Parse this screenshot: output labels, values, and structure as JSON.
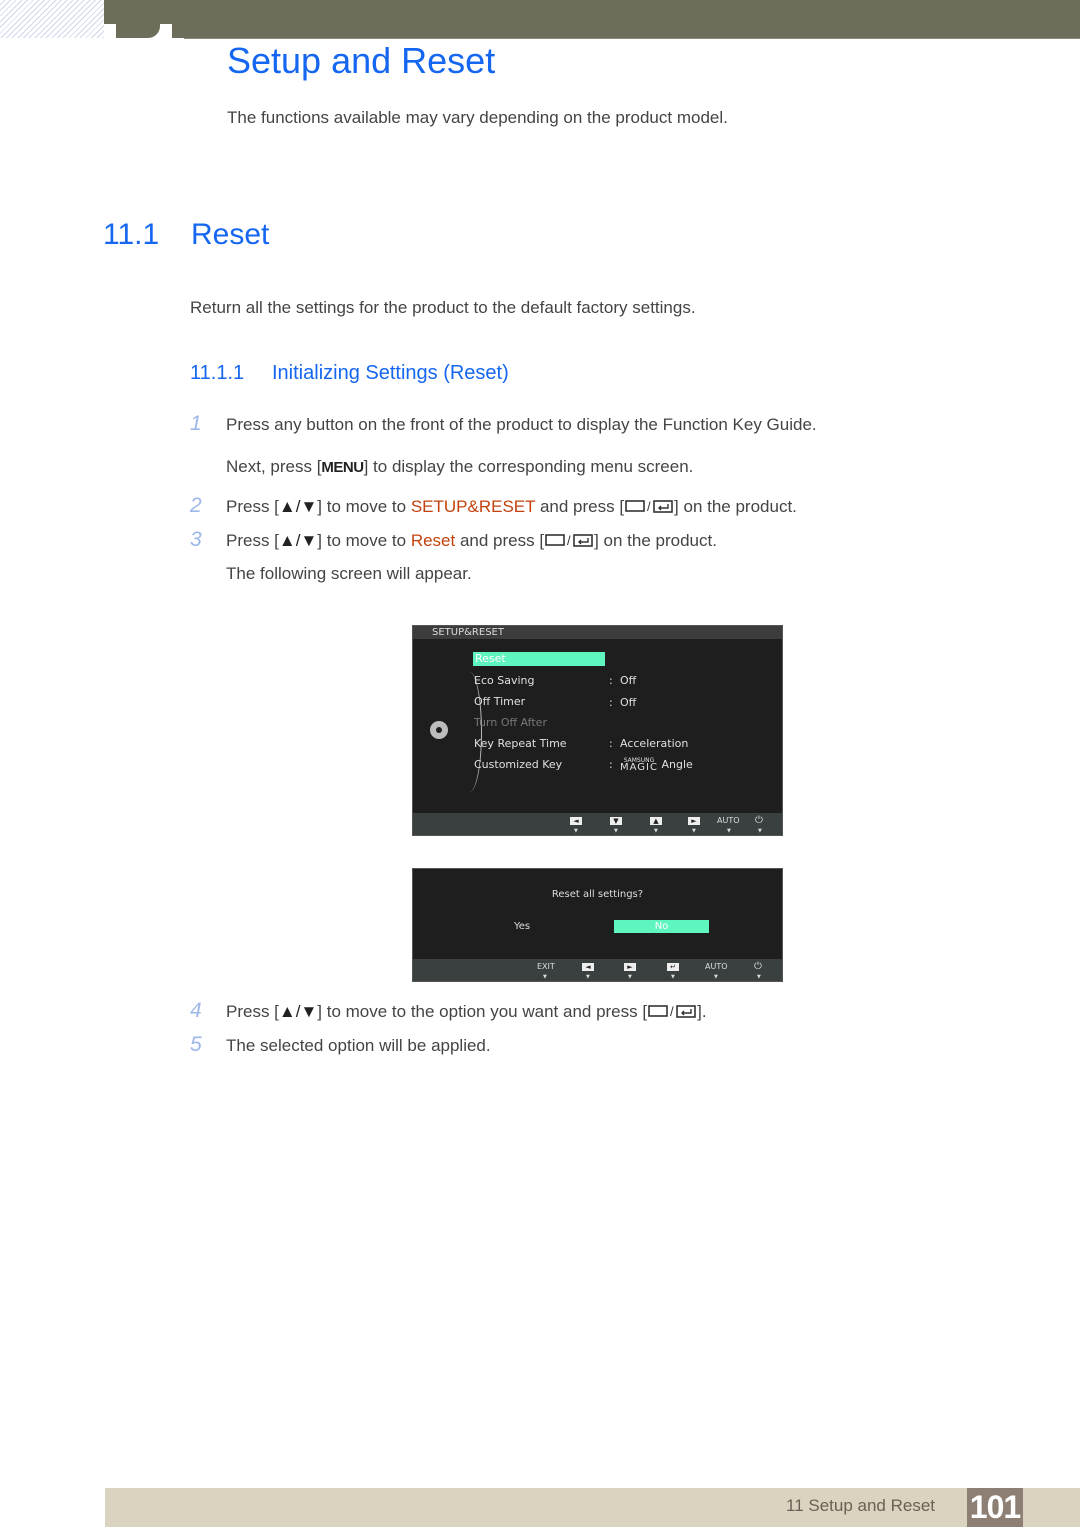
{
  "header": {
    "title": "Setup and Reset",
    "intro": "The functions available may vary depending on the product model."
  },
  "section": {
    "number": "11.1",
    "title": "Reset",
    "description": "Return all the settings for the product to the default factory settings."
  },
  "subsection": {
    "number": "11.1.1",
    "title": "Initializing Settings (Reset)"
  },
  "steps": [
    {
      "n": "1",
      "text": "Press any button on the front of the product to display the Function Key Guide.",
      "sub_before": "Next, press [",
      "sub_key": "MENU",
      "sub_after": "] to display the corresponding menu screen."
    },
    {
      "n": "2",
      "pre": "Press [",
      "arrows": "▲/▼",
      "mid": "] to move to ",
      "highlight": "SETUP&RESET",
      "post": " and press [",
      "end": "] on the product."
    },
    {
      "n": "3",
      "pre": "Press [",
      "arrows": "▲/▼",
      "mid": "] to move to ",
      "highlight": "Reset",
      "post": " and press [",
      "end": "] on the product.",
      "sub": "The following screen will appear."
    },
    {
      "n": "4",
      "pre": "Press [",
      "arrows": "▲/▼",
      "mid": "] to move to the option you want and press [",
      "end": "]."
    },
    {
      "n": "5",
      "text": "The selected option will be applied."
    }
  ],
  "osd_menu": {
    "title": "SETUP&RESET",
    "items": [
      {
        "label": "Reset",
        "value": ""
      },
      {
        "label": "Eco Saving",
        "value": "Off"
      },
      {
        "label": "Off Timer",
        "value": "Off"
      },
      {
        "label": "Turn Off After",
        "value": ""
      },
      {
        "label": "Key Repeat Time",
        "value": "Acceleration"
      },
      {
        "label": "Customized Key",
        "value_brand_top": "SAMSUNG",
        "value_brand": "MAGIC",
        "value": "Angle"
      }
    ],
    "buttons": [
      "◄",
      "▼",
      "▲",
      "►",
      "AUTO",
      "⏻"
    ],
    "accent": "#5ff5bf"
  },
  "osd_dialog": {
    "question": "Reset all settings?",
    "yes": "Yes",
    "no": "No",
    "buttons": [
      "EXIT",
      "◄",
      "►",
      "↵",
      "AUTO",
      "⏻"
    ]
  },
  "footer": {
    "label": "11 Setup and Reset",
    "page": "101"
  },
  "colors": {
    "heading": "#1566f0",
    "highlight": "#c2410c",
    "topbar": "#6e6d5a"
  }
}
